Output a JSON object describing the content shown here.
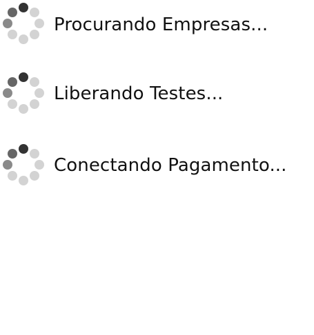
{
  "loading_steps": [
    {
      "label": "Procurando Empresas...",
      "icon": "loading-spinner-icon"
    },
    {
      "label": "Liberando Testes...",
      "icon": "loading-spinner-icon"
    },
    {
      "label": "Conectando Pagamento...",
      "icon": "loading-spinner-icon"
    }
  ],
  "colors": {
    "text": "#111111",
    "dot_dark": "#333333",
    "dot_mid": "#777777",
    "dot_light": "#d3d3d3",
    "background": "#ffffff"
  }
}
